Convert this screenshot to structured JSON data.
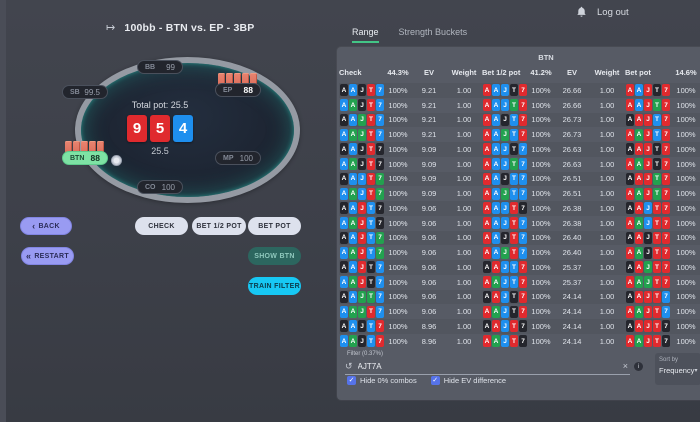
{
  "app": {
    "title": "100bb - BTN vs. EP - 3BP",
    "logout_label": "Log out"
  },
  "icons": {
    "title_arrow": "↦",
    "back_chevron": "‹",
    "restart_chevron": "«",
    "undo": "↺",
    "clear": "×",
    "info": "i",
    "sort_caret": "▾",
    "checkmark": "✓"
  },
  "table": {
    "total_pot": "Total pot: 25.5",
    "street_bet": "25.5",
    "board": [
      {
        "rank": "9",
        "suit": "h"
      },
      {
        "rank": "5",
        "suit": "h"
      },
      {
        "rank": "4",
        "suit": "d"
      }
    ],
    "seats": [
      {
        "pos": "BB",
        "stack": "99",
        "kind": "folded",
        "loc": "bb",
        "cards": false,
        "dealer": false
      },
      {
        "pos": "SB",
        "stack": "99.5",
        "kind": "folded",
        "loc": "sb",
        "cards": false,
        "dealer": false
      },
      {
        "pos": "EP",
        "stack": "88",
        "kind": "villain",
        "loc": "ep",
        "cards": true,
        "dealer": false
      },
      {
        "pos": "MP",
        "stack": "100",
        "kind": "folded",
        "loc": "mp",
        "cards": false,
        "dealer": false
      },
      {
        "pos": "CO",
        "stack": "100",
        "kind": "folded",
        "loc": "co",
        "cards": false,
        "dealer": false
      },
      {
        "pos": "BTN",
        "stack": "88",
        "kind": "hero",
        "loc": "btn",
        "cards": true,
        "dealer": true
      }
    ]
  },
  "actions": {
    "back": "BACK",
    "restart": "RESTART",
    "check": "CHECK",
    "bet_half": "BET 1/2 POT",
    "bet_pot": "BET POT",
    "show_btn": "SHOW BTN",
    "train_filter": "TRAIN FILTER"
  },
  "panel": {
    "tabs": [
      {
        "label": "Range",
        "active": true
      },
      {
        "label": "Strength Buckets",
        "active": false
      }
    ],
    "position_label": "BTN",
    "headers": {
      "check": "Check",
      "check_pct": "44.3%",
      "ev1": "EV",
      "weight1": "Weight",
      "bet_half": "Bet 1/2 pot",
      "bet_half_pct": "41.2%",
      "ev2": "EV",
      "weight2": "Weight",
      "bet_pot": "Bet pot",
      "bet_pot_pct": "14.6%"
    },
    "ranks": "AAJT7",
    "suit_colors": {
      "s": "#25262d",
      "h": "#e02a2e",
      "d": "#1e8fee",
      "c": "#23a14f"
    },
    "rows": [
      {
        "check": {
          "cards": "sdshd",
          "pct": "100%",
          "ev": "9.21",
          "weight": "1.00"
        },
        "bet_half": {
          "cards": "hddsh",
          "pct": "100%",
          "ev": "26.66",
          "weight": "1.00"
        },
        "bet_pot": {
          "cards": "hdhsh",
          "pct": "100%"
        }
      },
      {
        "check": {
          "cards": "dcshd",
          "pct": "100%",
          "ev": "9.21",
          "weight": "1.00"
        },
        "bet_half": {
          "cards": "hddch",
          "pct": "100%",
          "ev": "26.66",
          "weight": "1.00"
        },
        "bet_pot": {
          "cards": "hdhch",
          "pct": "100%"
        }
      },
      {
        "check": {
          "cards": "sdchd",
          "pct": "100%",
          "ev": "9.21",
          "weight": "1.00"
        },
        "bet_half": {
          "cards": "hdsdh",
          "pct": "100%",
          "ev": "26.73",
          "weight": "1.00"
        },
        "bet_pot": {
          "cards": "shhdh",
          "pct": "100%"
        }
      },
      {
        "check": {
          "cards": "dcchd",
          "pct": "100%",
          "ev": "9.21",
          "weight": "1.00"
        },
        "bet_half": {
          "cards": "hdcdh",
          "pct": "100%",
          "ev": "26.73",
          "weight": "1.00"
        },
        "bet_pot": {
          "cards": "hchdh",
          "pct": "100%"
        }
      },
      {
        "check": {
          "cards": "sdshs",
          "pct": "100%",
          "ev": "9.09",
          "weight": "1.00"
        },
        "bet_half": {
          "cards": "hddsd",
          "pct": "100%",
          "ev": "26.63",
          "weight": "1.00"
        },
        "bet_pot": {
          "cards": "shhsh",
          "pct": "100%"
        }
      },
      {
        "check": {
          "cards": "dcshs",
          "pct": "100%",
          "ev": "9.09",
          "weight": "1.00"
        },
        "bet_half": {
          "cards": "hddcd",
          "pct": "100%",
          "ev": "26.63",
          "weight": "1.00"
        },
        "bet_pot": {
          "cards": "hchsh",
          "pct": "100%"
        }
      },
      {
        "check": {
          "cards": "sddhc",
          "pct": "100%",
          "ev": "9.09",
          "weight": "1.00"
        },
        "bet_half": {
          "cards": "hdsdd",
          "pct": "100%",
          "ev": "26.51",
          "weight": "1.00"
        },
        "bet_pot": {
          "cards": "shhch",
          "pct": "100%"
        }
      },
      {
        "check": {
          "cards": "dcdhc",
          "pct": "100%",
          "ev": "9.09",
          "weight": "1.00"
        },
        "bet_half": {
          "cards": "hdcdd",
          "pct": "100%",
          "ev": "26.51",
          "weight": "1.00"
        },
        "bet_pot": {
          "cards": "hchch",
          "pct": "100%"
        }
      },
      {
        "check": {
          "cards": "sdhds",
          "pct": "100%",
          "ev": "9.06",
          "weight": "1.00"
        },
        "bet_half": {
          "cards": "hddhs",
          "pct": "100%",
          "ev": "26.38",
          "weight": "1.00"
        },
        "bet_pot": {
          "cards": "shdhh",
          "pct": "100%"
        }
      },
      {
        "check": {
          "cards": "dchds",
          "pct": "100%",
          "ev": "9.06",
          "weight": "1.00"
        },
        "bet_half": {
          "cards": "hddhd",
          "pct": "100%",
          "ev": "26.38",
          "weight": "1.00"
        },
        "bet_pot": {
          "cards": "hcdhh",
          "pct": "100%"
        }
      },
      {
        "check": {
          "cards": "sdhdc",
          "pct": "100%",
          "ev": "9.06",
          "weight": "1.00"
        },
        "bet_half": {
          "cards": "hdshd",
          "pct": "100%",
          "ev": "26.40",
          "weight": "1.00"
        },
        "bet_pot": {
          "cards": "shshh",
          "pct": "100%"
        }
      },
      {
        "check": {
          "cards": "dchdc",
          "pct": "100%",
          "ev": "9.06",
          "weight": "1.00"
        },
        "bet_half": {
          "cards": "hdchd",
          "pct": "100%",
          "ev": "26.40",
          "weight": "1.00"
        },
        "bet_pot": {
          "cards": "hcshh",
          "pct": "100%"
        }
      },
      {
        "check": {
          "cards": "sdhsd",
          "pct": "100%",
          "ev": "9.06",
          "weight": "1.00"
        },
        "bet_half": {
          "cards": "shddh",
          "pct": "100%",
          "ev": "25.37",
          "weight": "1.00"
        },
        "bet_pot": {
          "cards": "shchh",
          "pct": "100%"
        }
      },
      {
        "check": {
          "cards": "dchsd",
          "pct": "100%",
          "ev": "9.06",
          "weight": "1.00"
        },
        "bet_half": {
          "cards": "hcddh",
          "pct": "100%",
          "ev": "25.37",
          "weight": "1.00"
        },
        "bet_pot": {
          "cards": "hcchh",
          "pct": "100%"
        }
      },
      {
        "check": {
          "cards": "sdccd",
          "pct": "100%",
          "ev": "9.06",
          "weight": "1.00"
        },
        "bet_half": {
          "cards": "shdsh",
          "pct": "100%",
          "ev": "24.14",
          "weight": "1.00"
        },
        "bet_pot": {
          "cards": "shhhd",
          "pct": "100%"
        }
      },
      {
        "check": {
          "cards": "dcchd",
          "pct": "100%",
          "ev": "9.06",
          "weight": "1.00"
        },
        "bet_half": {
          "cards": "hcdsh",
          "pct": "100%",
          "ev": "24.14",
          "weight": "1.00"
        },
        "bet_pot": {
          "cards": "hchhd",
          "pct": "100%"
        }
      },
      {
        "check": {
          "cards": "sdsdh",
          "pct": "100%",
          "ev": "8.96",
          "weight": "1.00"
        },
        "bet_half": {
          "cards": "shdhs",
          "pct": "100%",
          "ev": "24.14",
          "weight": "1.00"
        },
        "bet_pot": {
          "cards": "shhhs",
          "pct": "100%"
        }
      },
      {
        "check": {
          "cards": "dcsdh",
          "pct": "100%",
          "ev": "8.96",
          "weight": "1.00"
        },
        "bet_half": {
          "cards": "hcdhs",
          "pct": "100%",
          "ev": "24.14",
          "weight": "1.00"
        },
        "bet_pot": {
          "cards": "hchhs",
          "pct": "100%"
        }
      }
    ],
    "filter": {
      "label": "Filter (0.37%)",
      "value": "AJT7A"
    },
    "sort": {
      "label": "Sort by",
      "value": "Frequency"
    },
    "checkboxes": [
      {
        "label": "Hide 0% combos",
        "checked": true
      },
      {
        "label": "Hide EV difference",
        "checked": true
      }
    ]
  }
}
